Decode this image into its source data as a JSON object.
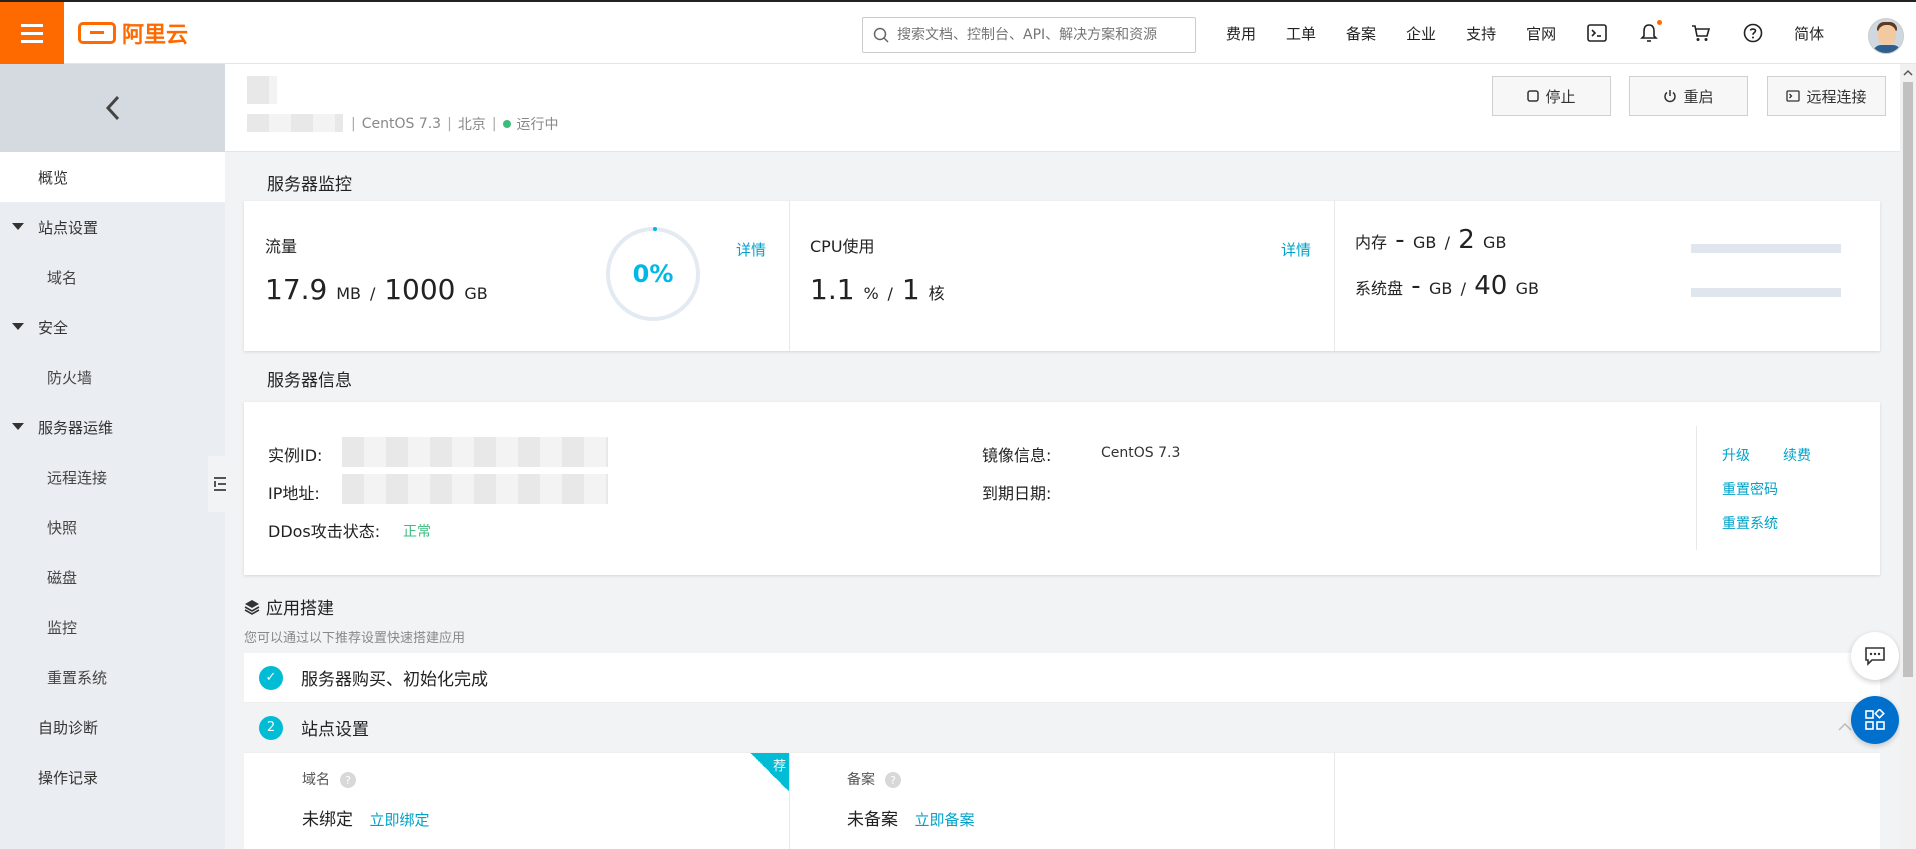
{
  "topbar": {
    "logo_text": "阿里云",
    "search_placeholder": "搜索文档、控制台、API、解决方案和资源",
    "links": [
      "费用",
      "工单",
      "备案",
      "企业",
      "支持",
      "官网"
    ],
    "lang": "简体",
    "icons": [
      "menu-icon",
      "search-icon",
      "terminal-icon",
      "bell-icon",
      "cart-icon",
      "help-icon"
    ]
  },
  "sidebar": {
    "items": [
      {
        "label": "概览",
        "type": "item",
        "active": true
      },
      {
        "label": "站点设置",
        "type": "group"
      },
      {
        "label": "域名",
        "type": "sub"
      },
      {
        "label": "安全",
        "type": "group"
      },
      {
        "label": "防火墙",
        "type": "sub"
      },
      {
        "label": "服务器运维",
        "type": "group"
      },
      {
        "label": "远程连接",
        "type": "sub"
      },
      {
        "label": "快照",
        "type": "sub"
      },
      {
        "label": "磁盘",
        "type": "sub"
      },
      {
        "label": "监控",
        "type": "sub"
      },
      {
        "label": "重置系统",
        "type": "sub"
      },
      {
        "label": "自助诊断",
        "type": "item"
      },
      {
        "label": "操作记录",
        "type": "item"
      }
    ]
  },
  "header": {
    "os": "CentOS 7.3",
    "region": "北京",
    "status": "运行中",
    "sep": "|",
    "buttons": {
      "stop": "停止",
      "restart": "重启",
      "remote": "远程连接"
    }
  },
  "monitor": {
    "title": "服务器监控",
    "traffic": {
      "label": "流量",
      "used": "17.9",
      "used_unit": "MB",
      "total": "1000",
      "total_unit": "GB",
      "percent": "0%",
      "detail": "详情"
    },
    "cpu": {
      "label": "CPU使用",
      "used": "1.1",
      "used_unit": "%",
      "total": "1",
      "total_unit": "核",
      "detail": "详情"
    },
    "memory": {
      "label": "内存",
      "used": "-",
      "used_unit": "GB",
      "total": "2",
      "total_unit": "GB",
      "fill": 0
    },
    "disk": {
      "label": "系统盘",
      "used": "-",
      "used_unit": "GB",
      "total": "40",
      "total_unit": "GB",
      "fill": 0
    },
    "slash": "/"
  },
  "info": {
    "title": "服务器信息",
    "instance_id_label": "实例ID:",
    "ip_label": "IP地址:",
    "ddos_label": "DDos攻击状态:",
    "ddos_value": "正常",
    "image_label": "镜像信息:",
    "image_value": "CentOS 7.3",
    "expire_label": "到期日期:",
    "ops": {
      "upgrade": "升级",
      "renew": "续费",
      "reset_pwd": "重置密码",
      "reset_sys": "重置系统"
    }
  },
  "app": {
    "title": "应用搭建",
    "subtitle": "您可以通过以下推荐设置快速搭建应用",
    "step1": {
      "badge": "✓",
      "label": "服务器购买、初始化完成"
    },
    "step2": {
      "badge": "2",
      "label": "站点设置"
    },
    "domain": {
      "label": "域名",
      "status": "未绑定",
      "action": "立即绑定",
      "tag": "荐"
    },
    "beian": {
      "label": "备案",
      "status": "未备案",
      "action": "立即备案"
    },
    "help": "?"
  },
  "colors": {
    "brand": "#ff6a00",
    "accent": "#00b7e6",
    "link": "#00a2ca",
    "ok": "#3dbd7d"
  }
}
